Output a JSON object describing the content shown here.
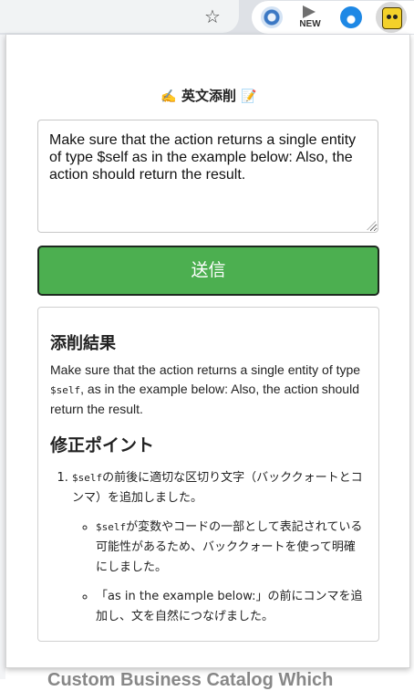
{
  "browser": {
    "star_icon": "☆",
    "ext_badge": "NEW"
  },
  "page": {
    "background_text": "Custom Business Catalog Which"
  },
  "popup": {
    "title": "英文添削",
    "title_icon_left": "✍️",
    "title_icon_right": "📝",
    "input_text": "Make sure that the action returns a single entity of type $self as in the example below: Also, the action should return the result.",
    "send_label": "送信",
    "result_heading": "添削結果",
    "corrected": {
      "before": "Make sure that the action returns a single entity of type ",
      "code": "$self",
      "after": ", as in the example below: Also, the action should return the result."
    },
    "points_heading": "修正ポイント",
    "points": [
      {
        "code": "$self",
        "text": "の前後に適切な区切り文字（バッククォートとコンマ）を追加しました。",
        "sub": [
          {
            "code": "$self",
            "text": "が変数やコードの一部として表記されている可能性があるため、バッククォートを使って明確にしました。"
          },
          {
            "code": "",
            "text": "「as in the example below:」の前にコンマを追加し、文を自然につなげました。"
          }
        ]
      }
    ]
  },
  "colors": {
    "send_button": "#4caf50",
    "toolbar": "#dee1e6"
  }
}
